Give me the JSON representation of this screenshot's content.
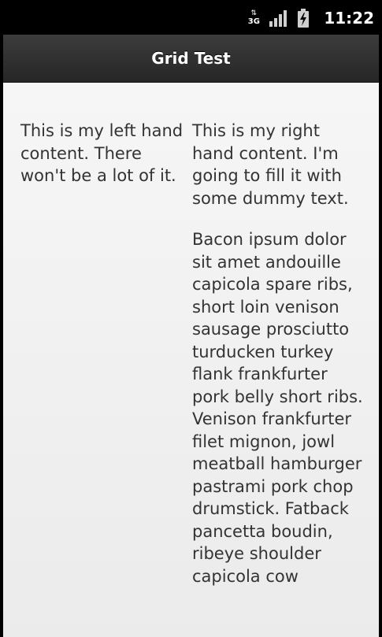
{
  "status_bar": {
    "network_label": "3G",
    "time": "11:22"
  },
  "header": {
    "title": "Grid Test"
  },
  "content": {
    "left_text": "This is my left hand content. There won't be a lot of it.",
    "right_paragraphs": [
      "This is my right hand content. I'm going to fill it with some dummy text.",
      "Bacon ipsum dolor sit amet andouille capicola spare ribs, short loin venison sausage prosciutto turducken turkey flank frankfurter pork belly short ribs. Venison frankfurter filet mignon, jowl meatball hamburger pastrami pork chop drumstick. Fatback pancetta boudin, ribeye shoulder capicola cow"
    ]
  }
}
